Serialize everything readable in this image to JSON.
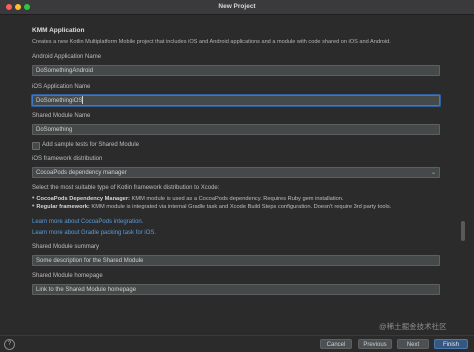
{
  "window": {
    "title": "New Project"
  },
  "form": {
    "heading": "KMM Application",
    "description": "Creates a new Kotlin Multiplatform Mobile project that includes iOS and Android applications and a module with code shared on iOS and Android.",
    "android_app_name": {
      "label": "Android Application Name",
      "value": "DoSomethingAndroid"
    },
    "ios_app_name": {
      "label": "iOS Application Name",
      "value": "DoSomethingiOS"
    },
    "shared_module_name": {
      "label": "Shared Module Name",
      "value": "DoSomething"
    },
    "add_sample_tests": {
      "label": "Add sample tests for Shared Module",
      "checked": false
    },
    "ios_distribution": {
      "label": "iOS framework distribution",
      "value": "CocoaPods dependency manager"
    },
    "distribution_info": {
      "intro": "Select the most suitable type of Kotlin framework distribution to Xcode:",
      "bullets": [
        {
          "title": "CocoaPods Dependency Manager:",
          "text": " KMM module is used as a CocoaPods dependency. Requires Ruby gem installation."
        },
        {
          "title": "Regular framework:",
          "text": " KMM module is integrated via internal Gradle task and Xcode Build Steps configuration. Doesn't require 3rd party tools."
        }
      ]
    },
    "links": [
      "Learn more about CocoaPods integration.",
      "Learn more about Gradle packing task for iOS."
    ],
    "shared_module_summary": {
      "label": "Shared Module summary",
      "value": "Some description for the Shared Module"
    },
    "shared_module_homepage": {
      "label": "Shared Module homepage",
      "value": "Link to the Shared Module homepage"
    }
  },
  "footer": {
    "help_label": "?",
    "cancel_label": "Cancel",
    "previous_label": "Previous",
    "next_label": "Next",
    "finish_label": "Finish"
  },
  "watermark": "@稀土掘金技术社区",
  "colors": {
    "background": "#2b2b2b",
    "focus": "#3d77c9",
    "link": "#5a9bd8",
    "primary_button": "#365880"
  }
}
